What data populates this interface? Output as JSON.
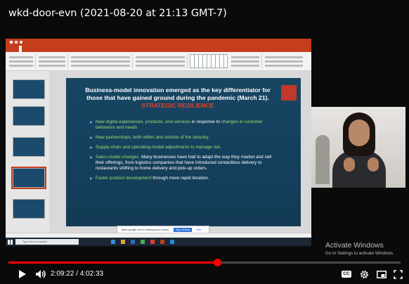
{
  "video": {
    "title": "wkd-door-evn (2021-08-20 at 21:13 GMT-7)",
    "time_current": "2:09:22",
    "time_total": "4:02:33",
    "time_display": "2:09:22 / 4:02:33",
    "progress_fraction": 0.534
  },
  "slide": {
    "heading_part1": "Business-model innovation emerged as the key differentiator for those that have gained ground during the pandemic (March 21).",
    "heading_red": "STRATEGIC RESILIENCE",
    "bullets": [
      {
        "green": "New digital experiences, products, and services",
        "white": " in response to",
        "green2": " changes in customer behaviors and needs"
      },
      {
        "green": "New partnerships, both within and outside of the industry.",
        "white": "",
        "green2": ""
      },
      {
        "green": "Supply-chain and operating-model adjustments to manage risk.",
        "white": "",
        "green2": ""
      },
      {
        "green": "Sales-model changes.",
        "white": " Many businesses have had to adapt the way they market and sell their offerings, from logistics companies that have introduced contactless delivery to restaurants shifting to home delivery and pick-up orders.",
        "green2": ""
      },
      {
        "green": "Faster product development",
        "white": " through more rapid iteration.",
        "green2": ""
      }
    ]
  },
  "share_notice": {
    "message": "Meet.google.com is sharing your screen.",
    "stop_label": "Stop sharing",
    "hide_label": "Hide"
  },
  "taskbar": {
    "search_placeholder": "Type here to search"
  },
  "watermark": {
    "line1": "Activate Windows",
    "line2": "Go to Settings to activate Windows."
  },
  "colors": {
    "accent_progress": "#ff0000",
    "ppt_brand": "#c43e1c",
    "slide_bg": "#174663",
    "bullet_green": "#9ee06b"
  },
  "icons": [
    "play-icon",
    "volume-icon",
    "subtitles-icon",
    "settings-gear-icon",
    "miniplayer-icon",
    "fullscreen-icon"
  ]
}
